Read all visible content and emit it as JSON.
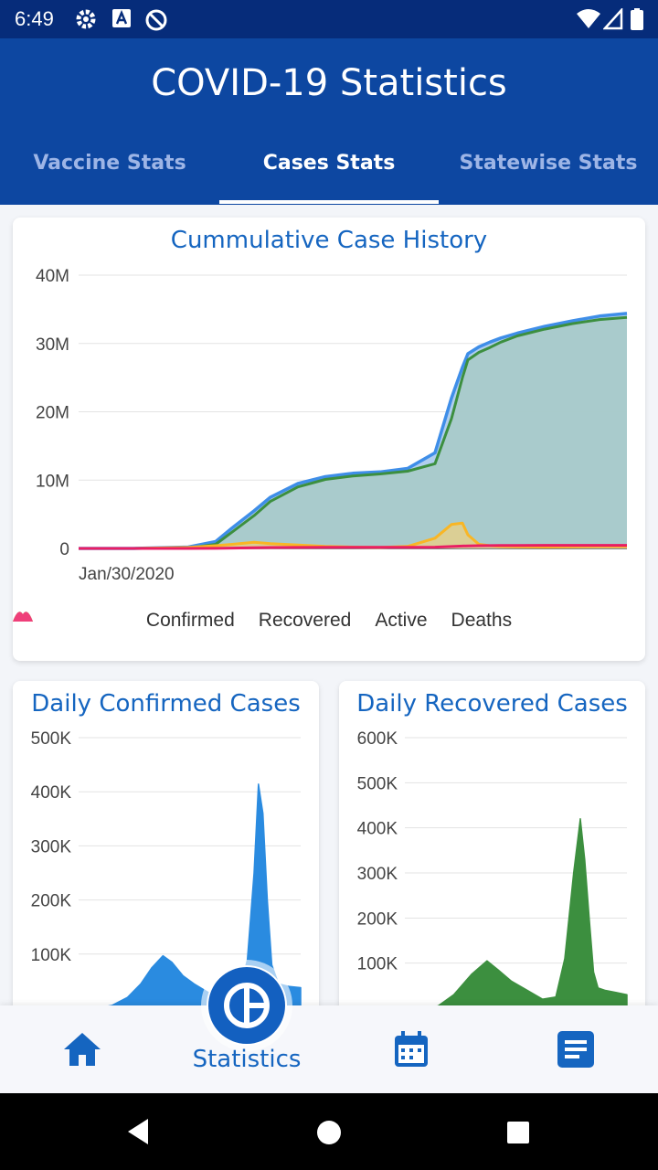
{
  "status_bar": {
    "time": "6:49",
    "icons": [
      "gear-icon",
      "a-box-icon",
      "no-sync-icon",
      "wifi-icon",
      "signal-icon",
      "battery-icon"
    ]
  },
  "app_bar": {
    "title": "COVID-19 Statistics"
  },
  "tabs": [
    {
      "label": "Vaccine Stats",
      "active": false
    },
    {
      "label": "Cases Stats",
      "active": true
    },
    {
      "label": "Statewise Stats",
      "active": false
    }
  ],
  "colors": {
    "primary": "#0d47a1",
    "status_bar": "#062c7a",
    "confirmed": "#3f8ee8",
    "recovered": "#3c8f3f",
    "active": "#f9b625",
    "deaths": "#e91e63"
  },
  "chart_data": [
    {
      "type": "area",
      "title": "Cummulative Case History",
      "x_tick_labels": [
        "Jan/30/2020"
      ],
      "y_tick_labels": [
        "0",
        "10M",
        "20M",
        "30M",
        "40M"
      ],
      "ylim": [
        0,
        40000000
      ],
      "grid": true,
      "legend_position": "bottom",
      "x": [
        0,
        0.1,
        0.2,
        0.25,
        0.28,
        0.32,
        0.35,
        0.4,
        0.45,
        0.5,
        0.55,
        0.6,
        0.65,
        0.68,
        0.7,
        0.71,
        0.73,
        0.75,
        0.77,
        0.8,
        0.85,
        0.9,
        0.95,
        1.0
      ],
      "series": [
        {
          "name": "Confirmed",
          "values": [
            0,
            0,
            200000,
            1000000,
            3000000,
            5500000,
            7500000,
            9500000,
            10500000,
            11000000,
            11200000,
            11700000,
            14000000,
            22000000,
            26500000,
            28500000,
            29500000,
            30200000,
            30800000,
            31500000,
            32500000,
            33300000,
            34000000,
            34400000
          ]
        },
        {
          "name": "Recovered",
          "values": [
            0,
            0,
            50000,
            600000,
            2400000,
            4800000,
            6900000,
            9000000,
            10100000,
            10600000,
            10900000,
            11300000,
            12400000,
            19000000,
            25000000,
            27600000,
            28700000,
            29400000,
            30200000,
            31100000,
            32100000,
            32900000,
            33500000,
            33800000
          ]
        },
        {
          "name": "Active",
          "values": [
            0,
            0,
            150000,
            400000,
            600000,
            900000,
            700000,
            500000,
            300000,
            200000,
            150000,
            300000,
            1500000,
            3500000,
            3700000,
            2000000,
            600000,
            400000,
            300000,
            250000,
            200000,
            250000,
            300000,
            300000
          ]
        },
        {
          "name": "Deaths",
          "values": [
            0,
            0,
            0,
            20000,
            60000,
            100000,
            130000,
            150000,
            160000,
            160000,
            160000,
            165000,
            190000,
            280000,
            350000,
            380000,
            400000,
            420000,
            430000,
            440000,
            450000,
            455000,
            460000,
            460000
          ]
        }
      ]
    },
    {
      "type": "area",
      "title": "Daily Confirmed Cases",
      "y_tick_labels": [
        "100K",
        "200K",
        "300K",
        "400K",
        "500K"
      ],
      "ylim": [
        0,
        500000
      ],
      "grid": true,
      "series": [
        {
          "name": "Confirmed",
          "x": [
            0,
            0.08,
            0.15,
            0.22,
            0.28,
            0.33,
            0.38,
            0.42,
            0.47,
            0.52,
            0.58,
            0.65,
            0.72,
            0.76,
            0.79,
            0.81,
            0.83,
            0.85,
            0.87,
            0.9,
            0.95,
            1.0
          ],
          "values": [
            0,
            0,
            5000,
            20000,
            45000,
            75000,
            97000,
            85000,
            60000,
            45000,
            30000,
            15000,
            20000,
            90000,
            250000,
            414000,
            360000,
            200000,
            80000,
            45000,
            40000,
            38000
          ]
        }
      ]
    },
    {
      "type": "area",
      "title": "Daily Recovered Cases",
      "y_tick_labels": [
        "100K",
        "200K",
        "300K",
        "400K",
        "500K",
        "600K"
      ],
      "ylim": [
        0,
        600000
      ],
      "grid": true,
      "series": [
        {
          "name": "Recovered",
          "x": [
            0,
            0.08,
            0.15,
            0.22,
            0.3,
            0.37,
            0.42,
            0.48,
            0.55,
            0.62,
            0.68,
            0.72,
            0.76,
            0.79,
            0.81,
            0.83,
            0.85,
            0.87,
            0.9,
            0.95,
            1.0
          ],
          "values": [
            0,
            0,
            5000,
            30000,
            75000,
            105000,
            85000,
            60000,
            40000,
            20000,
            25000,
            110000,
            300000,
            420000,
            330000,
            200000,
            80000,
            45000,
            40000,
            35000,
            30000
          ]
        }
      ]
    }
  ],
  "bottom_nav": {
    "items": [
      {
        "icon": "home-icon"
      },
      {
        "icon": "statistics-icon",
        "label": "Statistics",
        "active": true
      },
      {
        "icon": "calendar-icon"
      },
      {
        "icon": "notes-icon"
      }
    ]
  },
  "system_nav": {
    "icons": [
      "back-icon",
      "home-circle-icon",
      "recents-icon"
    ]
  }
}
